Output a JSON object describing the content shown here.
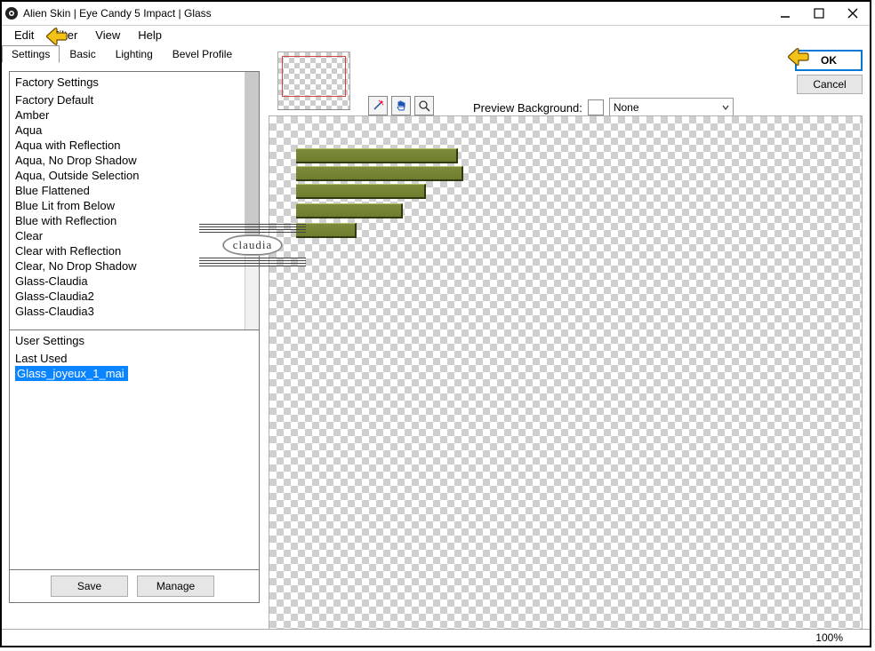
{
  "title": "Alien Skin | Eye Candy 5 Impact | Glass",
  "menu": {
    "items": [
      "Edit",
      "Filter",
      "View",
      "Help"
    ]
  },
  "tabs": {
    "items": [
      "Settings",
      "Basic",
      "Lighting",
      "Bevel Profile"
    ],
    "active_index": 0
  },
  "buttons": {
    "ok": "OK",
    "cancel": "Cancel",
    "save": "Save",
    "manage": "Manage"
  },
  "preview_bg": {
    "label": "Preview Background:",
    "selected": "None"
  },
  "zoom": "100%",
  "watermark": "claudia",
  "factory": {
    "heading": "Factory Settings",
    "items": [
      "Factory Default",
      "Amber",
      "Aqua",
      "Aqua with Reflection",
      "Aqua, No Drop Shadow",
      "Aqua, Outside Selection",
      "Blue Flattened",
      "Blue Lit from Below",
      "Blue with Reflection",
      "Clear",
      "Clear with Reflection",
      "Clear, No Drop Shadow",
      "Glass-Claudia",
      "Glass-Claudia2",
      "Glass-Claudia3"
    ]
  },
  "user": {
    "heading": "User Settings",
    "items": [
      "Last Used",
      "Glass_joyeux_1_mai"
    ],
    "selected_index": 1
  }
}
